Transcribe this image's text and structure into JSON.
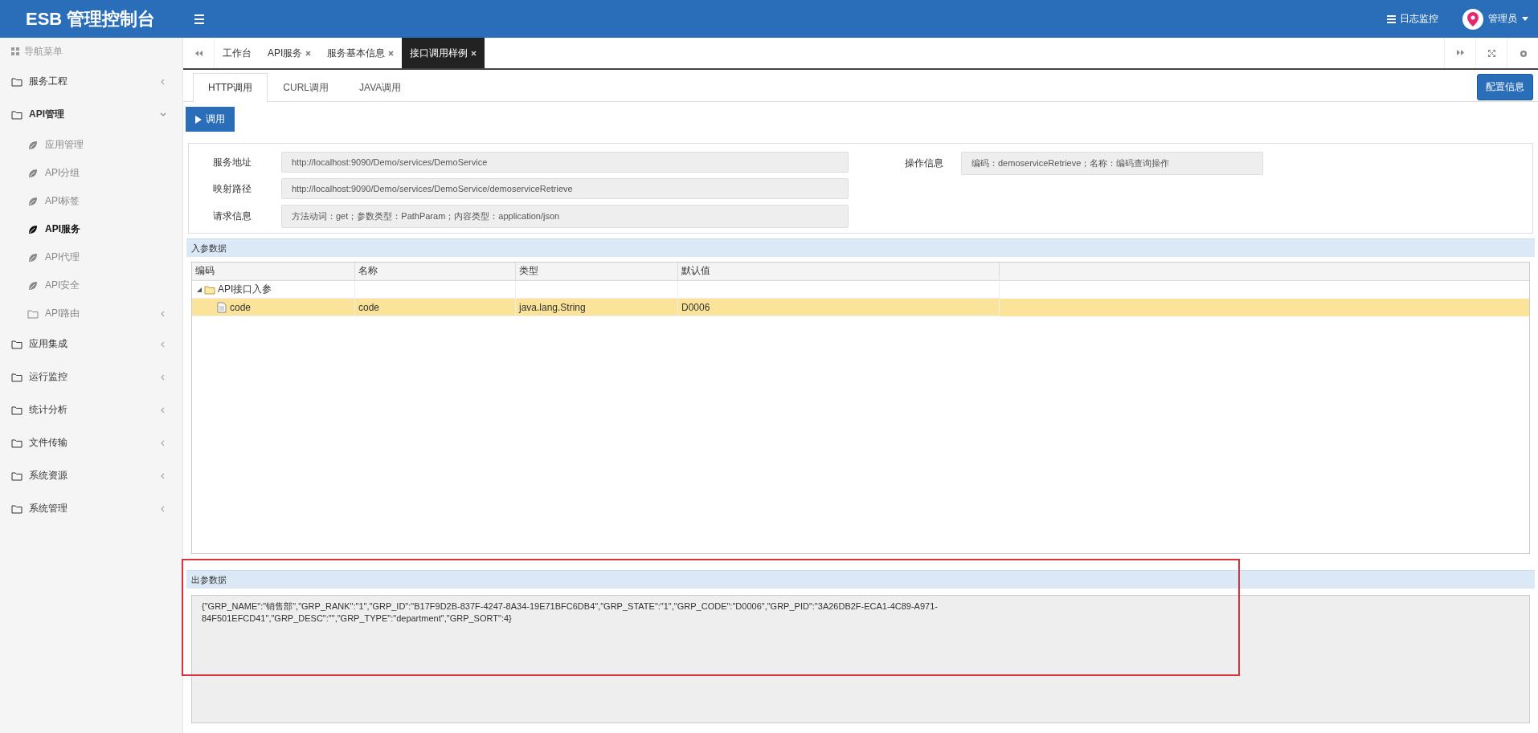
{
  "header": {
    "logo": "ESB 管理控制台",
    "log_link": "日志监控",
    "user": "管理员"
  },
  "sidebar": {
    "title": "导航菜单",
    "items": [
      {
        "label": "服务工程",
        "kind": "folder",
        "expanded": false,
        "selected": false
      },
      {
        "label": "API管理",
        "kind": "folder",
        "expanded": true,
        "selected": false,
        "children": [
          {
            "label": "应用管理",
            "kind": "page",
            "selected": false
          },
          {
            "label": "API分组",
            "kind": "page",
            "selected": false
          },
          {
            "label": "API标签",
            "kind": "page",
            "selected": false
          },
          {
            "label": "API服务",
            "kind": "page",
            "selected": true
          },
          {
            "label": "API代理",
            "kind": "page",
            "selected": false
          },
          {
            "label": "API安全",
            "kind": "page",
            "selected": false
          },
          {
            "label": "API路由",
            "kind": "folder",
            "expanded": false,
            "selected": false
          }
        ]
      },
      {
        "label": "应用集成",
        "kind": "folder",
        "expanded": false,
        "selected": false
      },
      {
        "label": "运行监控",
        "kind": "folder",
        "expanded": false,
        "selected": false
      },
      {
        "label": "统计分析",
        "kind": "folder",
        "expanded": false,
        "selected": false
      },
      {
        "label": "文件传输",
        "kind": "folder",
        "expanded": false,
        "selected": false
      },
      {
        "label": "系统资源",
        "kind": "folder",
        "expanded": false,
        "selected": false
      },
      {
        "label": "系统管理",
        "kind": "folder",
        "expanded": false,
        "selected": false
      }
    ]
  },
  "tabs": [
    {
      "label": "工作台",
      "closable": false,
      "selected": false
    },
    {
      "label": "API服务",
      "closable": true,
      "selected": false
    },
    {
      "label": "服务基本信息",
      "closable": true,
      "selected": false
    },
    {
      "label": "接口调用样例",
      "closable": true,
      "selected": true
    }
  ],
  "subtabs": [
    {
      "label": "HTTP调用",
      "selected": true
    },
    {
      "label": "CURL调用",
      "selected": false
    },
    {
      "label": "JAVA调用",
      "selected": false
    }
  ],
  "config_button": "配置信息",
  "invoke_button": "调用",
  "service_info": {
    "left": [
      {
        "label": "服务地址",
        "value": "http://localhost:9090/Demo/services/DemoService"
      },
      {
        "label": "映射路径",
        "value": "http://localhost:9090/Demo/services/DemoService/demoserviceRetrieve"
      },
      {
        "label": "请求信息",
        "value": "方法动词：get；参数类型：PathParam；内容类型：application/json"
      }
    ],
    "right": [
      {
        "label": "操作信息",
        "value": "编码：demoserviceRetrieve；名称：编码查询操作"
      }
    ]
  },
  "input_section": {
    "title": "入参数据",
    "table": {
      "columns": [
        "编码",
        "名称",
        "类型",
        "默认值"
      ],
      "rows": [
        {
          "kind": "folder",
          "cells": [
            "API接口入参",
            "",
            "",
            ""
          ],
          "expanded": true,
          "selected": false,
          "children": [
            {
              "kind": "file",
              "cells": [
                "code",
                "code",
                "java.lang.String",
                "D0006"
              ],
              "selected": true
            }
          ]
        }
      ]
    }
  },
  "output_section": {
    "title": "出参数据",
    "highlighted": true,
    "content": "{\"GRP_NAME\":\"销售部\",\"GRP_RANK\":\"1\",\"GRP_ID\":\"B17F9D2B-837F-4247-8A34-19E71BFC6DB4\",\"GRP_STATE\":\"1\",\"GRP_CODE\":\"D0006\",\"GRP_PID\":\"3A26DB2F-ECA1-4C89-A971-84F501EFCD41\",\"GRP_DESC\":\"\",\"GRP_TYPE\":\"department\",\"GRP_SORT\":4}"
  }
}
